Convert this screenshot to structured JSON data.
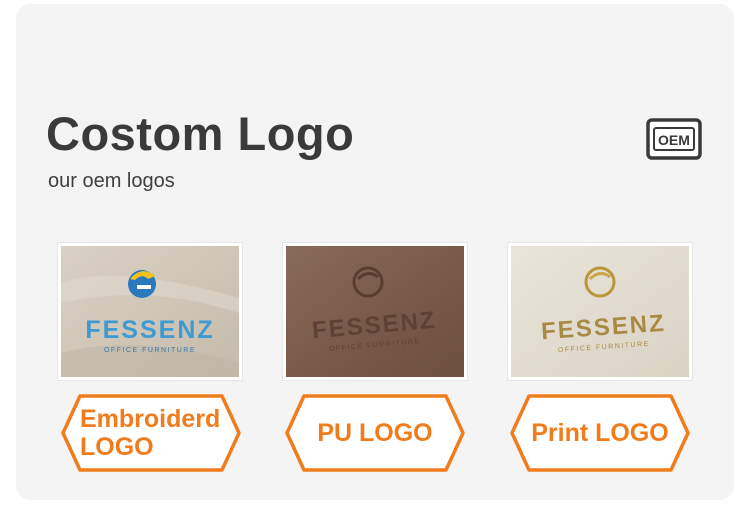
{
  "title": "Costom Logo",
  "subtitle": "our oem logos",
  "badge": {
    "icon": "oem-icon",
    "label": "OEM"
  },
  "accent_color": "#f07c1b",
  "samples": [
    {
      "name": "embroidered",
      "photo_logo": {
        "wordmark": "FESSENZ",
        "tagline": "OFFICE FURNITURE"
      },
      "label": "Embroiderd LOGO",
      "label_lines": [
        "Embroiderd",
        "LOGO"
      ]
    },
    {
      "name": "pu",
      "photo_logo": {
        "wordmark": "FESSENZ",
        "tagline": "OFFICE FURNITURE"
      },
      "label": "PU LOGO"
    },
    {
      "name": "print",
      "photo_logo": {
        "wordmark": "FESSENZ",
        "tagline": "OFFICE FURNITURE"
      },
      "label": "Print LOGO"
    }
  ]
}
